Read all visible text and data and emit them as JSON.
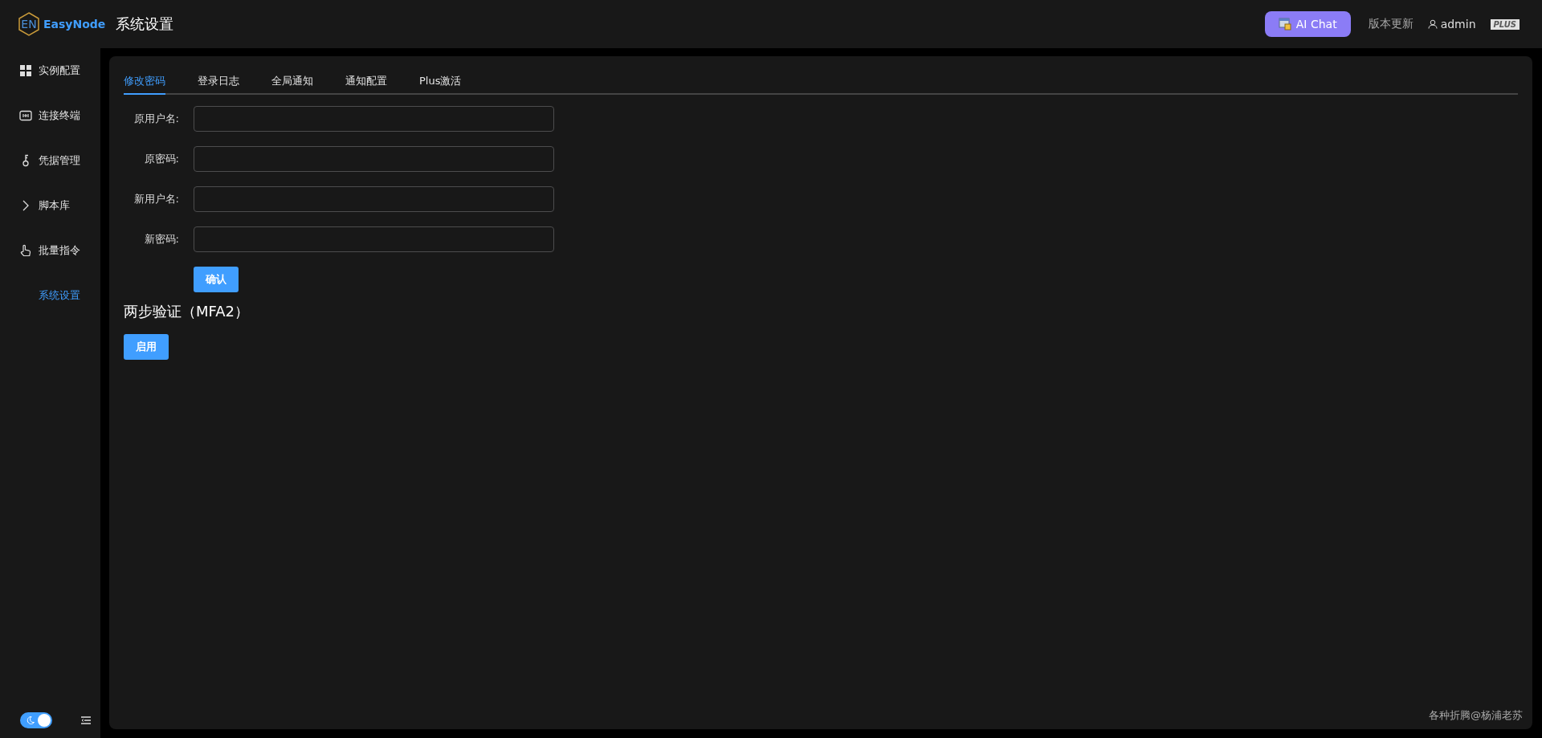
{
  "header": {
    "logo_mark": "EN",
    "logo_text": "EasyNode",
    "page_title": "系统设置",
    "ai_chat": "AI Chat",
    "update_link": "版本更新",
    "user": "admin",
    "plan_badge": "PLUS"
  },
  "sidebar": {
    "items": [
      {
        "label": "实例配置",
        "selected": false
      },
      {
        "label": "连接终端",
        "selected": false
      },
      {
        "label": "凭据管理",
        "selected": false
      },
      {
        "label": "脚本库",
        "selected": false
      },
      {
        "label": "批量指令",
        "selected": false
      },
      {
        "label": "系统设置",
        "selected": true
      }
    ],
    "theme_toggle": {
      "on": true
    }
  },
  "tabs": [
    {
      "label": "修改密码",
      "selected": true
    },
    {
      "label": "登录日志",
      "selected": false
    },
    {
      "label": "全局通知",
      "selected": false
    },
    {
      "label": "通知配置",
      "selected": false
    },
    {
      "label": "Plus激活",
      "selected": false
    }
  ],
  "form": {
    "fields": [
      {
        "label": "原用户名:"
      },
      {
        "label": "原密码:"
      },
      {
        "label": "新用户名:"
      },
      {
        "label": "新密码:"
      }
    ],
    "submit": "确认"
  },
  "mfa": {
    "title": "两步验证（MFA2）",
    "button": "启用"
  },
  "footer": "各种折腾@杨浦老苏"
}
